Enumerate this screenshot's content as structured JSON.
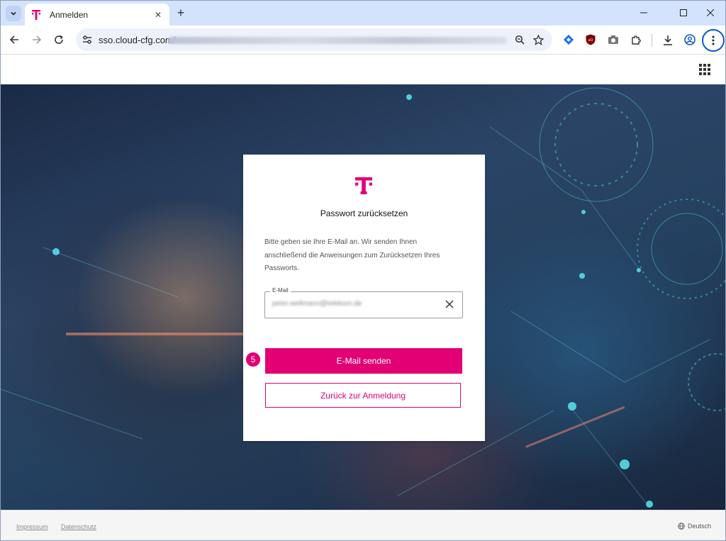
{
  "browser": {
    "tab_title": "Anmelden",
    "url_host": "sso.cloud-cfg.com",
    "url_separator": "/",
    "url_path_blurred": "realms/login/login-actions/reset-credentials?client_id=telekom&tab_id=..."
  },
  "card": {
    "title": "Passwort zurücksetzen",
    "description": "Bitte geben sie Ihre E-Mail an. Wir senden Ihnen anschließend die Anweisungen zum Zurücksetzen Ihres Passworts.",
    "email_label": "E-Mail",
    "email_value_blurred": "peter.wellmann@telekom.de",
    "primary_button": "E-Mail senden",
    "secondary_button": "Zurück zur Anmeldung"
  },
  "step_badge": "5",
  "footer": {
    "links": [
      "Impressum",
      "Datenschutz"
    ],
    "language": "Deutsch"
  },
  "colors": {
    "brand_magenta": "#e20074",
    "tabstrip": "#d3e3fd"
  }
}
